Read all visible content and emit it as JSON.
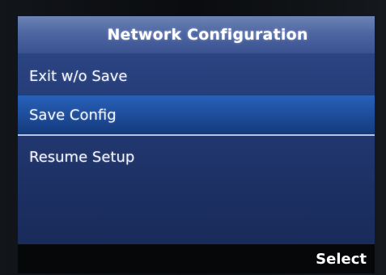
{
  "header": {
    "title": "Network Configuration"
  },
  "menu": {
    "items": [
      {
        "label": "Exit w/o Save",
        "selected": false
      },
      {
        "label": "Save Config",
        "selected": true
      },
      {
        "label": "Resume Setup",
        "selected": false
      }
    ]
  },
  "softkeys": {
    "right_label": "Select"
  },
  "colors": {
    "title_bar": "#4e66a1",
    "menu_background": "#233a73",
    "selected_item": "#1f4f9f",
    "divider": "#b7c4e4",
    "softkey_bar": "#050709",
    "text": "#ffffff"
  }
}
